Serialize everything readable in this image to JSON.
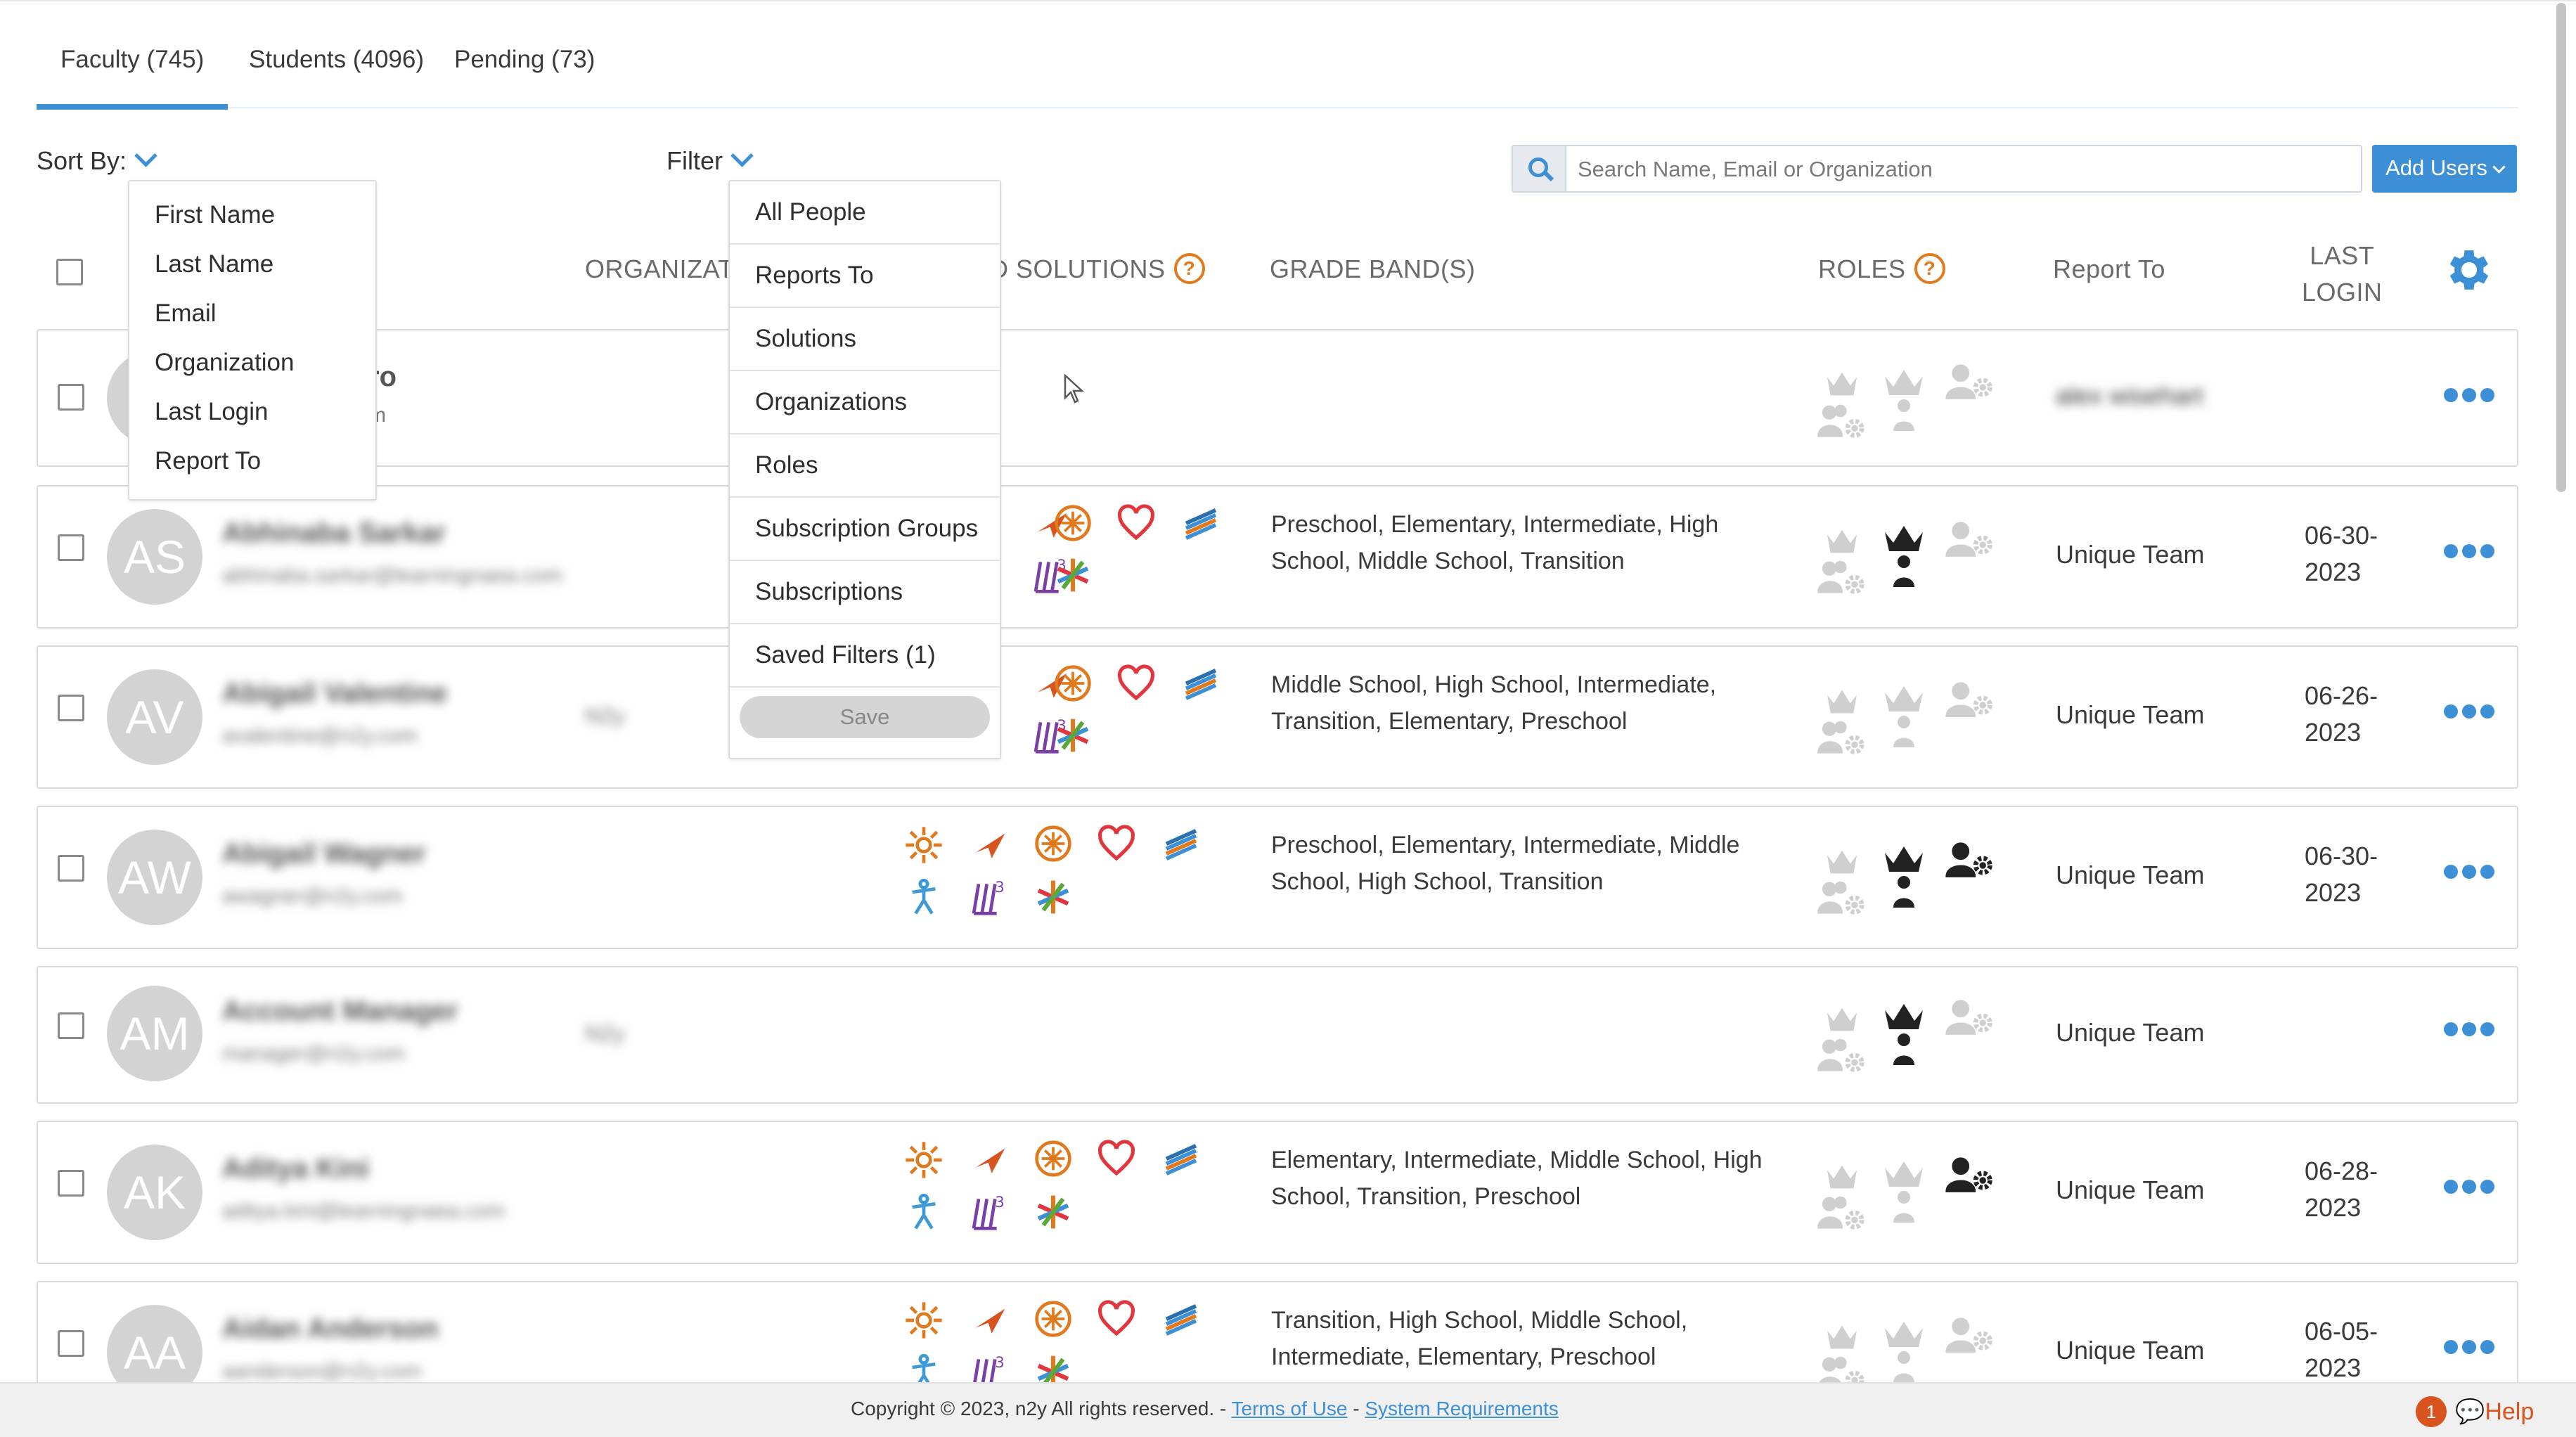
{
  "tabs": [
    {
      "label": "Faculty (745)",
      "active": true
    },
    {
      "label": "Students (4096)",
      "active": false
    },
    {
      "label": "Pending (73)",
      "active": false
    }
  ],
  "toolbar": {
    "sort_label": "Sort By:",
    "filter_label": "Filter",
    "search_placeholder": "Search Name, Email or Organization",
    "add_users_label": "Add Users"
  },
  "sort_menu": [
    "First Name",
    "Last Name",
    "Email",
    "Organization",
    "Last Login",
    "Report To"
  ],
  "filter_menu": {
    "items": [
      "All People",
      "Reports To",
      "Solutions",
      "Organizations",
      "Roles",
      "Subscription Groups",
      "Subscriptions",
      "Saved Filters (1)"
    ],
    "save_label": "Save"
  },
  "table_headers": {
    "organization": "ORGANIZAT",
    "solutions": "D SOLUTIONS",
    "grade_bands": "GRADE BAND(S)",
    "roles": "ROLES",
    "report_to": "Report To",
    "last_login_1": "LAST",
    "last_login_2": "LOGIN"
  },
  "rows": [
    {
      "initials": "",
      "name": "ro",
      "email": "m",
      "org": "",
      "grades_1": "",
      "grades_2": "",
      "report_to": "alex wisehart",
      "login_1": "",
      "login_2": "",
      "report_blurred": true
    },
    {
      "initials": "AS",
      "name": "Abhinaba Sarkar",
      "email": "abhinaba.sarkar@learningnaea.com",
      "org": "",
      "grades_1": "Preschool, Elementary, Intermediate, High",
      "grades_2": "School, Middle School, Transition",
      "report_to": "Unique Team",
      "login_1": "06-30-",
      "login_2": "2023"
    },
    {
      "initials": "AV",
      "name": "Abigail Valentine",
      "email": "avalentine@n2y.com",
      "org": "N2y",
      "grades_1": "Middle School, High School, Intermediate,",
      "grades_2": "Transition, Elementary, Preschool",
      "report_to": "Unique Team",
      "login_1": "06-26-",
      "login_2": "2023"
    },
    {
      "initials": "AW",
      "name": "Abigail Wagner",
      "email": "awagner@n2y.com",
      "org": "",
      "grades_1": "Preschool, Elementary, Intermediate, Middle",
      "grades_2": "School, High School, Transition",
      "report_to": "Unique Team",
      "login_1": "06-30-",
      "login_2": "2023"
    },
    {
      "initials": "AM",
      "name": "Account Manager",
      "email": "manager@n2y.com",
      "org": "N2y",
      "grades_1": "",
      "grades_2": "",
      "report_to": "Unique Team",
      "login_1": "",
      "login_2": ""
    },
    {
      "initials": "AK",
      "name": "Aditya Kini",
      "email": "aditya.kini@learningnaea.com",
      "org": "",
      "grades_1": "Elementary, Intermediate, Middle School, High",
      "grades_2": "School, Transition, Preschool",
      "report_to": "Unique Team",
      "login_1": "06-28-",
      "login_2": "2023"
    },
    {
      "initials": "AA",
      "name": "Aidan Anderson",
      "email": "aanderson@n2y.com",
      "org": "",
      "grades_1": "Transition, High School, Middle School,",
      "grades_2": "Intermediate, Elementary, Preschool",
      "report_to": "Unique Team",
      "login_1": "06-05-",
      "login_2": "2023"
    }
  ],
  "footer": {
    "copyright": "Copyright © 2023, n2y All rights reserved. - ",
    "sep": " - ",
    "terms": "Terms of Use",
    "requirements": "System Requirements",
    "help_count": "1",
    "help_label": "Help"
  },
  "colors": {
    "accent": "#3d8fd6",
    "orange": "#e07a1c",
    "red": "#e0373f",
    "purple": "#7b3fa8"
  }
}
